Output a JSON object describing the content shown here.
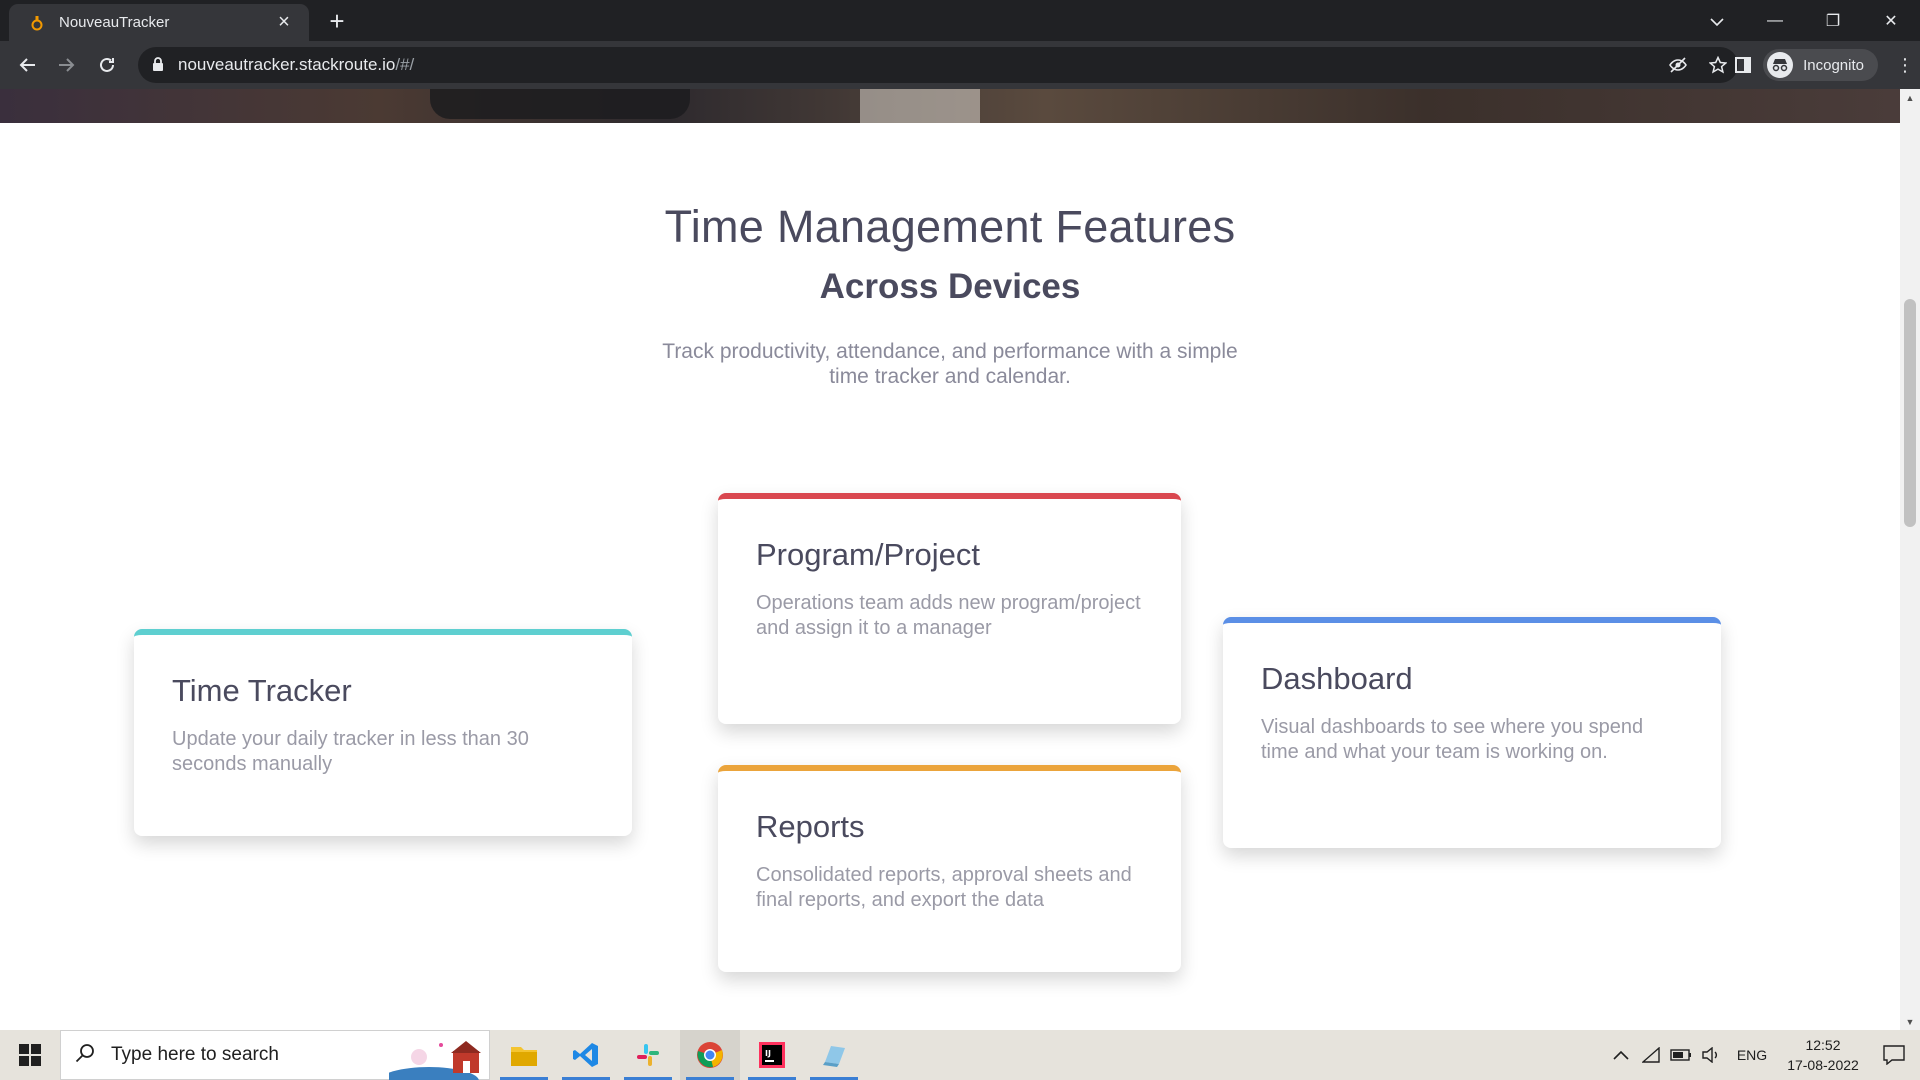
{
  "browser": {
    "tab_title": "NouveauTracker",
    "url_host": "nouveautracker.stackroute.io",
    "url_path": "/#/",
    "incognito_label": "Incognito"
  },
  "page": {
    "heading": "Time Management Features",
    "subheading": "Across Devices",
    "description": "Track productivity, attendance, and performance with a simple time tracker and calendar.",
    "cards": [
      {
        "title": "Time Tracker",
        "text": "Update your daily tracker in less than 30 seconds manually",
        "accent": "#5ecfd0"
      },
      {
        "title": "Program/Project",
        "text": "Operations team adds new program/project and assign it to a manager",
        "accent": "#d9474f"
      },
      {
        "title": "Reports",
        "text": "Consolidated reports, approval sheets and final reports, and export the data",
        "accent": "#eba43b"
      },
      {
        "title": "Dashboard",
        "text": "Visual dashboards to see where you spend time and what your team is working on.",
        "accent": "#5b8fe6"
      }
    ]
  },
  "taskbar": {
    "search_placeholder": "Type here to search",
    "apps": [
      "file-explorer-icon",
      "vscode-icon",
      "slack-icon",
      "chrome-icon",
      "intellij-icon",
      "notepad-icon"
    ],
    "language": "ENG",
    "time": "12:52",
    "date": "17-08-2022"
  }
}
